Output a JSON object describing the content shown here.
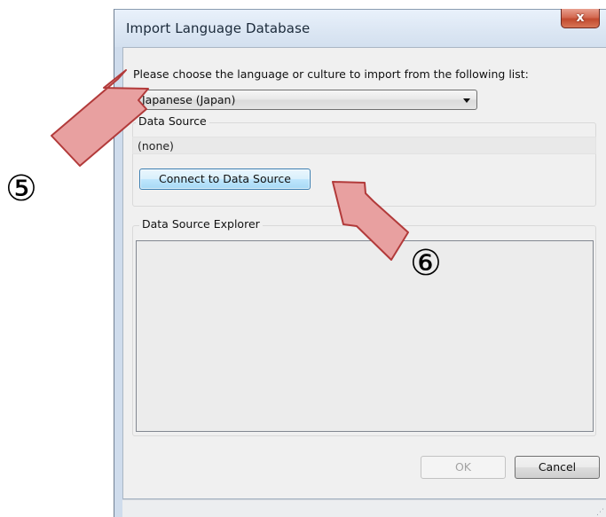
{
  "window": {
    "title": "Import Language Database",
    "close_glyph": "x"
  },
  "form": {
    "prompt": "Please choose the language or culture to import from the following list:",
    "language_select": {
      "selected": "Japanese (Japan)"
    },
    "data_source": {
      "group_label": "Data Source",
      "value": "(none)",
      "connect_label": "Connect to Data Source"
    },
    "explorer": {
      "group_label": "Data Source Explorer"
    }
  },
  "buttons": {
    "ok_label": "OK",
    "cancel_label": "Cancel"
  },
  "annotations": {
    "arrow_color": "#e8a0a0",
    "arrow_outline": "#b23a3a",
    "step5_label": "⑤",
    "step6_label": "⑥"
  }
}
